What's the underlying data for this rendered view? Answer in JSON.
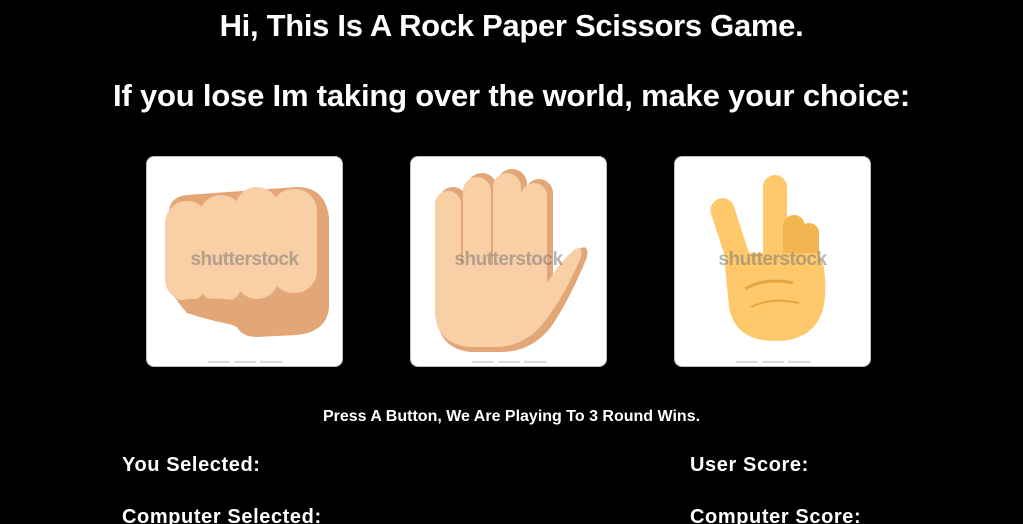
{
  "header": {
    "title": "Hi, This Is A Rock Paper Scissors Game.",
    "subtitle": "If you lose Im taking over the world, make your choice:"
  },
  "choices": [
    {
      "id": "rock",
      "icon": "fist-icon",
      "watermark": "shutterstock"
    },
    {
      "id": "paper",
      "icon": "open-hand-icon",
      "watermark": "shutterstock"
    },
    {
      "id": "scissors",
      "icon": "victory-hand-icon",
      "watermark": "shutterstock"
    }
  ],
  "instructions": "Press A Button, We Are Playing To 3 Round Wins.",
  "status": {
    "you_selected_label": "You Selected:",
    "computer_selected_label": "Computer Selected:",
    "user_score_label": "User Score:",
    "computer_score_label": "Computer Score:"
  },
  "colors": {
    "background": "#000000",
    "text": "#ffffff",
    "skin_light": "#f9cfa6",
    "skin_shadow": "#e3a677",
    "yellow_hand": "#ffc96b"
  }
}
